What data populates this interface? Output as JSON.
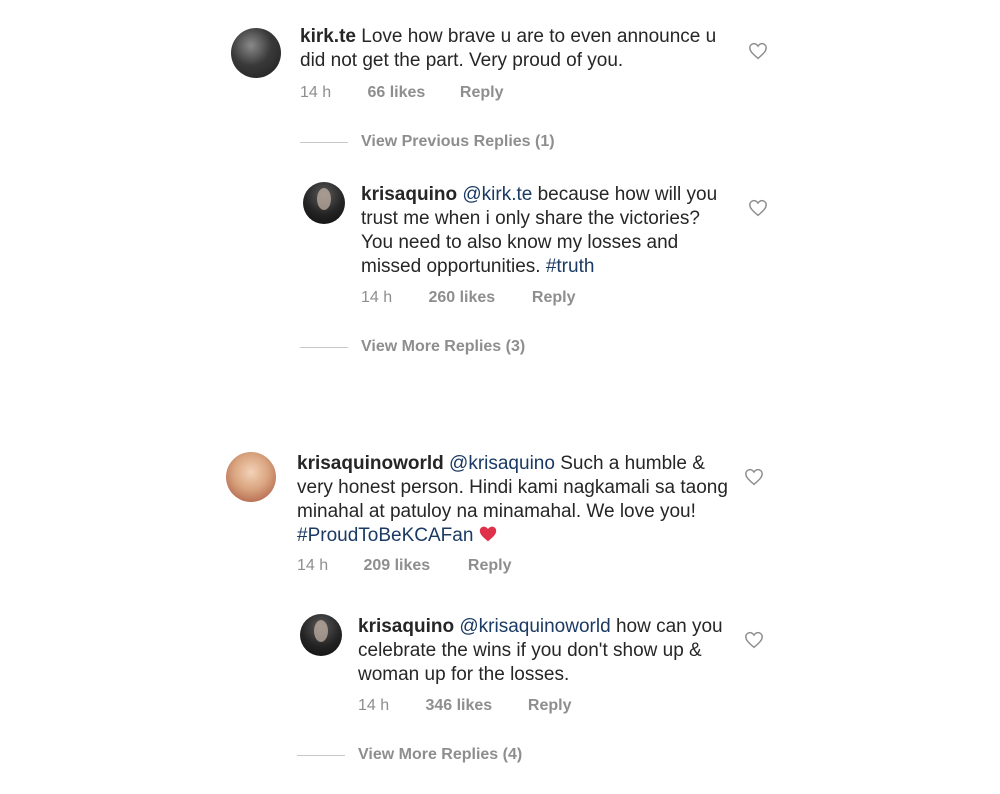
{
  "comments": [
    {
      "username": "kirk.te",
      "text": "Love how brave u are to even announce u did not get the part. Very proud of you.",
      "time": "14 h",
      "likes": "66 likes",
      "reply": "Reply"
    },
    {
      "username": "krisaquino",
      "mention": "@kirk.te",
      "text": "because how will you trust me when i only share the victories? You need to also know my losses and missed opportunities.",
      "hashtag": "#truth",
      "time": "14 h",
      "likes": "260 likes",
      "reply": "Reply"
    },
    {
      "username": "krisaquinoworld",
      "mention": "@krisaquino",
      "text": "Such a humble & very honest person. Hindi kami nagkamali sa taong minahal at patuloy na minamahal. We love you!",
      "hashtag": "#ProudToBeKCAFan",
      "time": "14 h",
      "likes": "209 likes",
      "reply": "Reply"
    },
    {
      "username": "krisaquino",
      "mention": "@krisaquinoworld",
      "text": "how can you celebrate the wins if you don't show up & woman up for the losses.",
      "time": "14 h",
      "likes": "346 likes",
      "reply": "Reply"
    }
  ],
  "view_replies": [
    "View Previous Replies (1)",
    "View More Replies (3)",
    "View More Replies (4)"
  ],
  "colors": {
    "link": "#1b3a63",
    "muted": "#8e8e8e",
    "heart_red": "#e0314a"
  },
  "icons": {
    "like": "heart-outline-icon",
    "emoji": "red-heart-icon"
  }
}
